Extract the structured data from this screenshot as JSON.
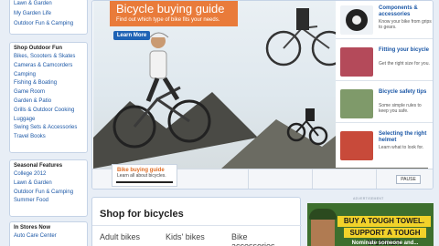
{
  "sidebar": {
    "top_links": [
      "Lawn & Garden",
      "My Garden Life",
      "Outdoor Fun & Camping"
    ],
    "shop_outdoor": {
      "heading": "Shop Outdoor Fun",
      "links": [
        "Bikes, Scooters & Skates",
        "Cameras & Camcorders",
        "Camping",
        "Fishing & Boating",
        "Game Room",
        "Garden & Patio",
        "Grills & Outdoor Cooking",
        "Luggage",
        "Swing Sets & Accessories",
        "Travel Books"
      ]
    },
    "seasonal": {
      "heading": "Seasonal Features",
      "links": [
        "College 2012",
        "Lawn & Garden",
        "Outdoor Fun & Camping",
        "Summer Food"
      ]
    },
    "in_stores": {
      "heading": "In Stores Now",
      "links": [
        "Auto Care Center"
      ]
    }
  },
  "hero": {
    "title": "Bicycle buying guide",
    "subtitle": "Find out which type of bike fits your needs.",
    "learn_more": "Learn More",
    "panel_items": [
      {
        "title": "Components & accessories",
        "desc": "Know your bike from grips to gears.",
        "thumb_color": "#9aa7b0",
        "icon": "bike-accessories-icon"
      },
      {
        "title": "Fitting your bicycle",
        "desc": "Get the right size for you.",
        "thumb_color": "#b44a5a",
        "icon": "bike-fit-icon"
      },
      {
        "title": "Bicycle safety tips",
        "desc": "Some simple rules to keep you safe.",
        "thumb_color": "#7f9a6a",
        "icon": "safety-icon"
      },
      {
        "title": "Selecting the right helmet",
        "desc": "Learn what to look for.",
        "thumb_color": "#c84a3a",
        "icon": "helmet-icon"
      }
    ],
    "active_tab": {
      "label": "Bike buying guide",
      "sub": "Learn all about bicycles."
    },
    "pause_label": "PAUSE"
  },
  "shop": {
    "heading": "Shop for bicycles",
    "categories": [
      "Adult bikes",
      "Kids' bikes",
      "Bike accessories"
    ]
  },
  "ad": {
    "label": "ADVERTISEMENT",
    "line1": "BUY A TOUGH TOWEL.",
    "line2": "SUPPORT A TOUGH WORKER.",
    "line3": "Nominate someone and..."
  }
}
